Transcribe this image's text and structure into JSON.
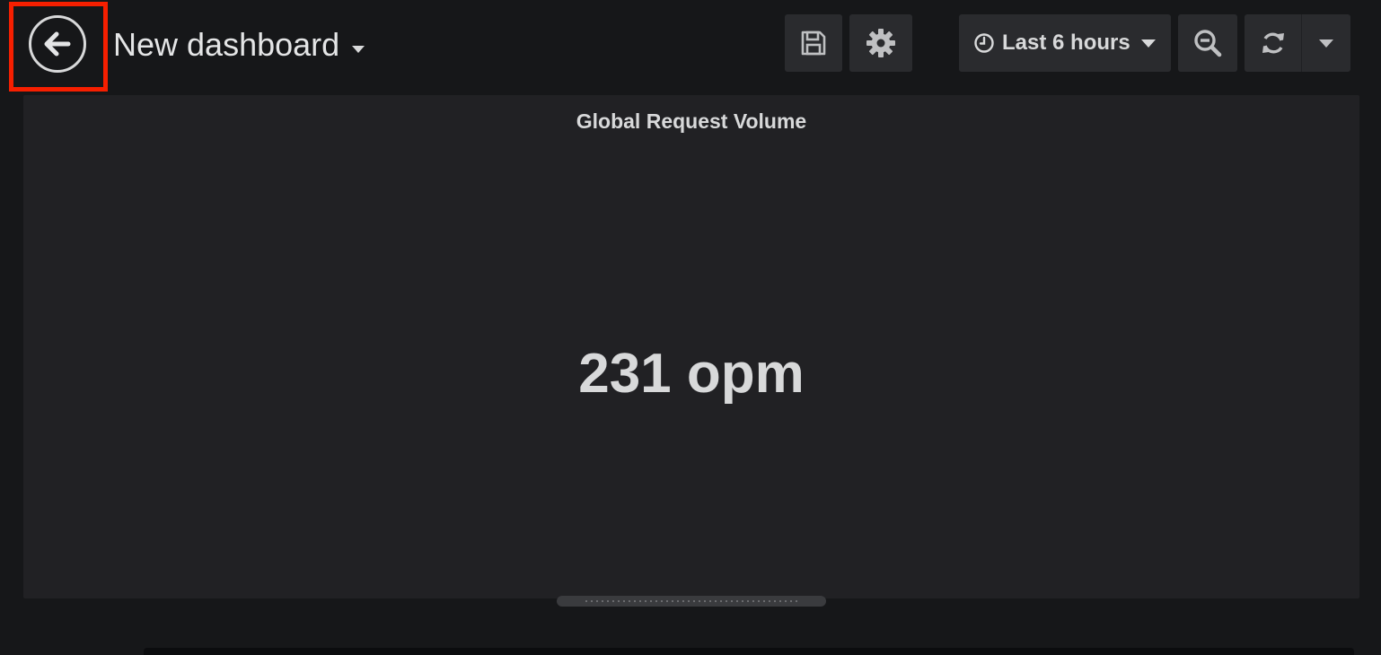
{
  "header": {
    "dashboard_title": "New dashboard",
    "time_range_label": "Last 6 hours"
  },
  "icons": {
    "back": "arrow-left-circle-icon",
    "title_caret": "caret-down-icon",
    "save": "save-icon",
    "settings": "gear-icon",
    "clock": "clock-icon",
    "time_caret": "caret-down-icon",
    "zoom_out": "zoom-out-icon",
    "refresh": "refresh-icon",
    "refresh_caret": "caret-down-icon"
  },
  "panel": {
    "title": "Global Request Volume",
    "stat_value": "231 opm"
  },
  "colors": {
    "background": "#161719",
    "panel_background": "#212124",
    "button_background": "#2a2b2e",
    "text": "#d8d9da",
    "annotation": "#f61f00"
  }
}
